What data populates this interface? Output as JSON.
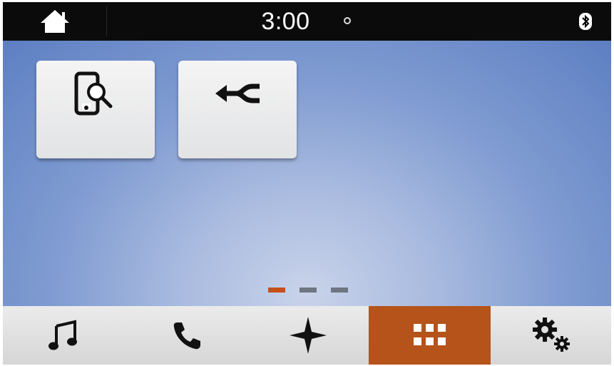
{
  "status_bar": {
    "time": "3:00"
  },
  "home_screen": {
    "tiles": [
      {
        "icon": "phone-search-icon"
      },
      {
        "icon": "merge-arrow-icon"
      }
    ],
    "page_indicator": {
      "pages": 3,
      "active_index": 0,
      "active_color": "#c4501c",
      "inactive_color": "#6f7681"
    }
  },
  "nav_bar": {
    "items": [
      {
        "icon": "music-note-icon"
      },
      {
        "icon": "phone-icon"
      },
      {
        "icon": "navigation-star-icon"
      },
      {
        "icon": "apps-grid-icon",
        "active": true
      },
      {
        "icon": "settings-gears-icon"
      }
    ],
    "active_color": "#b5531a"
  }
}
